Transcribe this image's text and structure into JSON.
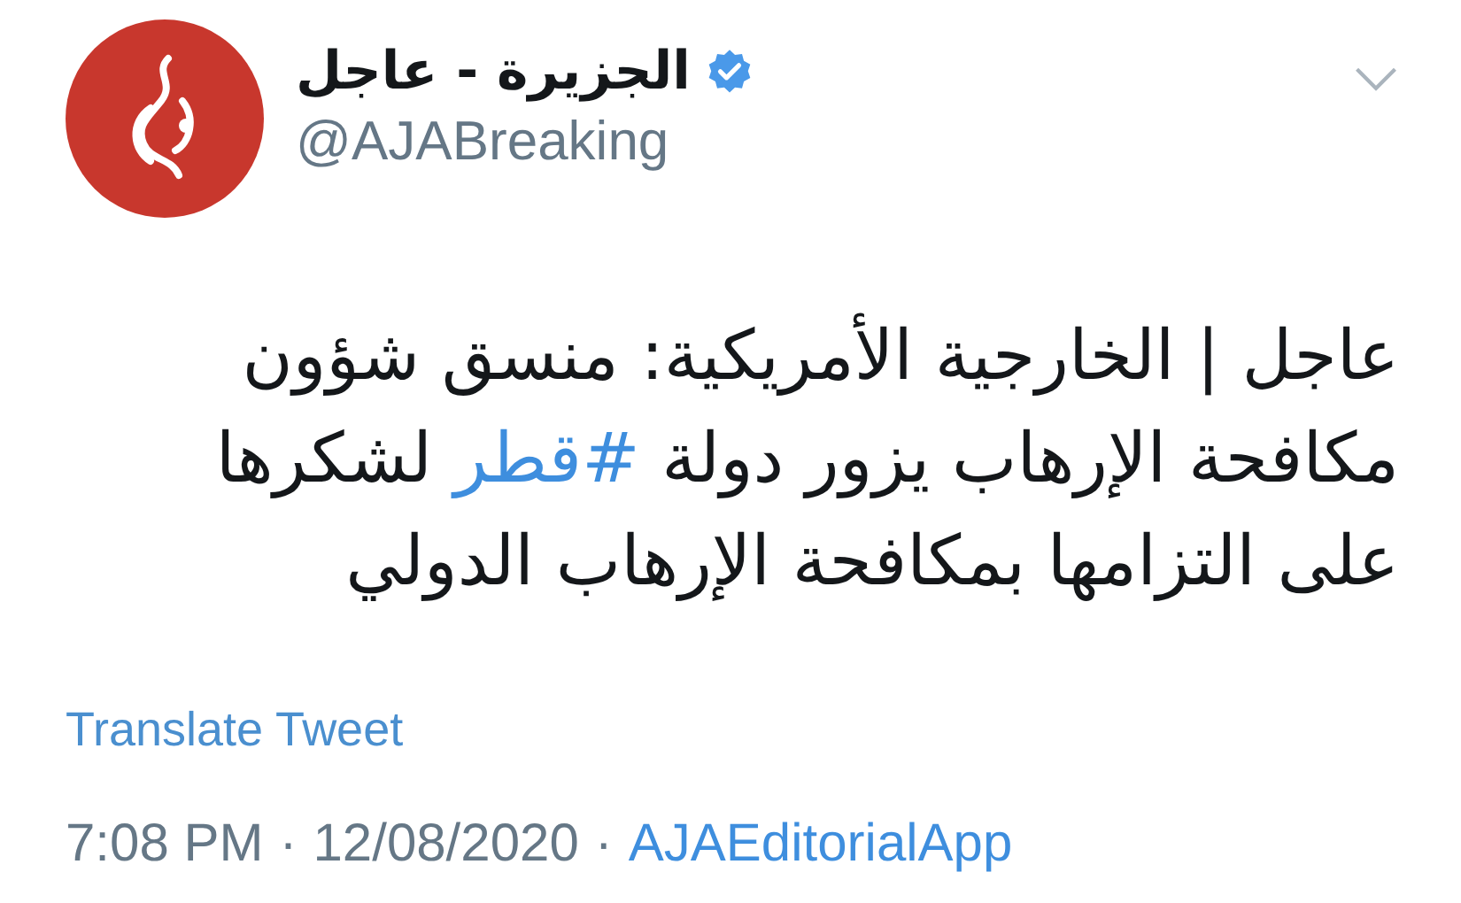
{
  "author": {
    "name": "الجزيرة - عاجل",
    "verified": true,
    "handle": "@AJABreaking"
  },
  "tweet": {
    "lines": [
      [
        {
          "kind": "text",
          "text": "عاجل | الخارجية الأمريكية: منسق شؤون"
        }
      ],
      [
        {
          "kind": "text",
          "text": "مكافحة الإرهاب يزور دولة "
        },
        {
          "kind": "hashtag",
          "text": "#قطر"
        },
        {
          "kind": "text",
          "text": " لشكرها"
        }
      ],
      [
        {
          "kind": "text",
          "text": "على التزامها بمكافحة الإرهاب الدولي"
        }
      ]
    ]
  },
  "translate": "Translate Tweet",
  "meta": {
    "time": "7:08 PM",
    "separator_1": "·",
    "date": "12/08/2020",
    "separator_2": "·",
    "source": "AJAEditorialApp"
  }
}
